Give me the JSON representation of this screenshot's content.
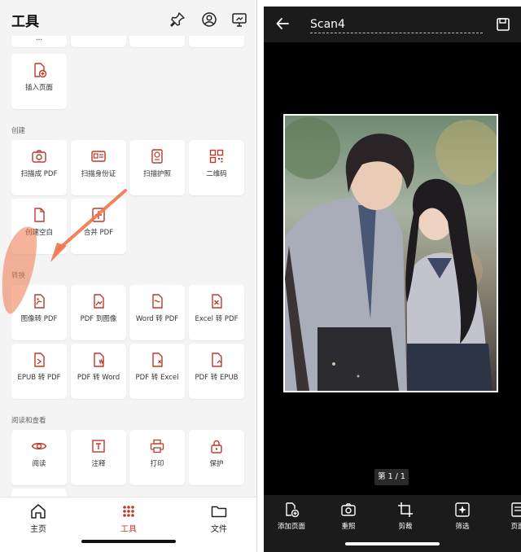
{
  "left": {
    "title": "工具",
    "sections": {
      "create": "创建",
      "convert": "转换",
      "read": "阅读和查看"
    },
    "tiles": {
      "partial_top": "...",
      "insert_page": "插入页面",
      "scan_pdf": "扫描成 PDF",
      "scan_id": "扫描身份证",
      "scan_passport": "扫描护照",
      "qr_code": "二维码",
      "create_blank": "创建空白",
      "merge_pdf": "合并 PDF",
      "image_to_pdf": "图像转 PDF",
      "pdf_to_image": "PDF 到图像",
      "word_to_pdf": "Word 转 PDF",
      "excel_to_pdf": "Excel 转 PDF",
      "epub_to_pdf": "EPUB 转 PDF",
      "pdf_to_word": "PDF 转 Word",
      "pdf_to_excel": "PDF 转 Excel",
      "pdf_to_epub": "PDF 转 EPUB",
      "read": "阅读",
      "annotate": "注释",
      "print": "打印",
      "protect": "保护"
    },
    "nav": {
      "home": "主页",
      "tools": "工具",
      "files": "文件"
    }
  },
  "right": {
    "filename": "Scan4",
    "page_indicator": "第 1 / 1",
    "toolbar": {
      "add_page": "添加页面",
      "retake": "重照",
      "crop": "剪裁",
      "filter": "筛选",
      "page": "页面"
    }
  },
  "colors": {
    "accent": "#c0392b",
    "annotation": "#f0764a",
    "dark_bg": "#000000",
    "dark_bar": "#1b1b1b"
  }
}
